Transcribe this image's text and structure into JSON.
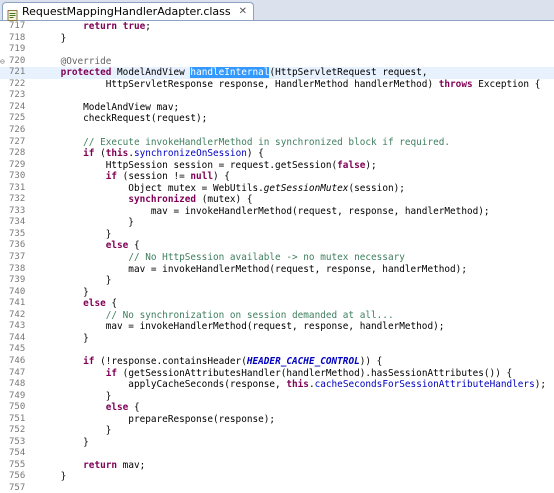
{
  "tab": {
    "title": "RequestMappingHandlerAdapter.class",
    "close_glyph": "✕",
    "icon": "class-file-icon"
  },
  "lines": [
    {
      "n": "717",
      "t": [
        [
          "        ",
          ""
        ],
        [
          "return",
          "kw"
        ],
        [
          " ",
          ""
        ],
        [
          "true",
          "kw"
        ],
        [
          ";",
          ""
        ]
      ]
    },
    {
      "n": "718",
      "t": [
        [
          "    }",
          ""
        ]
      ]
    },
    {
      "n": "719",
      "t": [
        [
          "",
          ""
        ]
      ]
    },
    {
      "n": "720",
      "t": [
        [
          "    ",
          ""
        ],
        [
          "@Override",
          "an"
        ]
      ],
      "fold": "⊖"
    },
    {
      "n": "721",
      "t": [
        [
          "    ",
          ""
        ],
        [
          "protected",
          "kw"
        ],
        [
          " ModelAndView ",
          ""
        ],
        [
          "handleInternal",
          "sel"
        ],
        [
          "(HttpServletRequest request,",
          ""
        ]
      ],
      "current": true
    },
    {
      "n": "722",
      "t": [
        [
          "            HttpServletResponse response, HandlerMethod handlerMethod) ",
          ""
        ],
        [
          "throws",
          "kw"
        ],
        [
          " Exception {",
          ""
        ]
      ]
    },
    {
      "n": "723",
      "t": [
        [
          "",
          ""
        ]
      ]
    },
    {
      "n": "724",
      "t": [
        [
          "        ModelAndView mav;",
          ""
        ]
      ]
    },
    {
      "n": "725",
      "t": [
        [
          "        checkRequest(request);",
          ""
        ]
      ]
    },
    {
      "n": "726",
      "t": [
        [
          "",
          ""
        ]
      ]
    },
    {
      "n": "727",
      "t": [
        [
          "        ",
          ""
        ],
        [
          "// Execute invokeHandlerMethod in synchronized block if required.",
          "cm"
        ]
      ]
    },
    {
      "n": "728",
      "t": [
        [
          "        ",
          ""
        ],
        [
          "if",
          "kw"
        ],
        [
          " (",
          ""
        ],
        [
          "this",
          "kw"
        ],
        [
          ".",
          ""
        ],
        [
          "synchronizeOnSession",
          "fld"
        ],
        [
          ") {",
          ""
        ]
      ]
    },
    {
      "n": "729",
      "t": [
        [
          "            HttpSession session = request.getSession(",
          ""
        ],
        [
          "false",
          "kw"
        ],
        [
          ");",
          ""
        ]
      ]
    },
    {
      "n": "730",
      "t": [
        [
          "            ",
          ""
        ],
        [
          "if",
          "kw"
        ],
        [
          " (session != ",
          ""
        ],
        [
          "null",
          "kw"
        ],
        [
          ") {",
          ""
        ]
      ]
    },
    {
      "n": "731",
      "t": [
        [
          "                Object mutex = WebUtils.",
          ""
        ],
        [
          "getSessionMutex",
          "it"
        ],
        [
          "(session);",
          ""
        ]
      ]
    },
    {
      "n": "732",
      "t": [
        [
          "                ",
          ""
        ],
        [
          "synchronized",
          "kw"
        ],
        [
          " (mutex) {",
          ""
        ]
      ]
    },
    {
      "n": "733",
      "t": [
        [
          "                    mav = invokeHandlerMethod(request, response, handlerMethod);",
          ""
        ]
      ]
    },
    {
      "n": "734",
      "t": [
        [
          "                }",
          ""
        ]
      ]
    },
    {
      "n": "735",
      "t": [
        [
          "            }",
          ""
        ]
      ]
    },
    {
      "n": "736",
      "t": [
        [
          "            ",
          ""
        ],
        [
          "else",
          "kw"
        ],
        [
          " {",
          ""
        ]
      ]
    },
    {
      "n": "737",
      "t": [
        [
          "                ",
          ""
        ],
        [
          "// No HttpSession available -> no mutex necessary",
          "cm"
        ]
      ]
    },
    {
      "n": "738",
      "t": [
        [
          "                mav = invokeHandlerMethod(request, response, handlerMethod);",
          ""
        ]
      ]
    },
    {
      "n": "739",
      "t": [
        [
          "            }",
          ""
        ]
      ]
    },
    {
      "n": "740",
      "t": [
        [
          "        }",
          ""
        ]
      ]
    },
    {
      "n": "741",
      "t": [
        [
          "        ",
          ""
        ],
        [
          "else",
          "kw"
        ],
        [
          " {",
          ""
        ]
      ]
    },
    {
      "n": "742",
      "t": [
        [
          "            ",
          ""
        ],
        [
          "// No synchronization on session demanded at all...",
          "cm"
        ]
      ]
    },
    {
      "n": "743",
      "t": [
        [
          "            mav = invokeHandlerMethod(request, response, handlerMethod);",
          ""
        ]
      ]
    },
    {
      "n": "744",
      "t": [
        [
          "        }",
          ""
        ]
      ]
    },
    {
      "n": "745",
      "t": [
        [
          "",
          ""
        ]
      ]
    },
    {
      "n": "746",
      "t": [
        [
          "        ",
          ""
        ],
        [
          "if",
          "kw"
        ],
        [
          " (!response.containsHeader(",
          ""
        ],
        [
          "HEADER_CACHE_CONTROL",
          "cst"
        ],
        [
          ")) {",
          ""
        ]
      ]
    },
    {
      "n": "747",
      "t": [
        [
          "            ",
          ""
        ],
        [
          "if",
          "kw"
        ],
        [
          " (getSessionAttributesHandler(handlerMethod).hasSessionAttributes()) {",
          ""
        ]
      ]
    },
    {
      "n": "748",
      "t": [
        [
          "                applyCacheSeconds(response, ",
          ""
        ],
        [
          "this",
          "kw"
        ],
        [
          ".",
          ""
        ],
        [
          "cacheSecondsForSessionAttributeHandlers",
          "fld"
        ],
        [
          ");",
          ""
        ]
      ]
    },
    {
      "n": "749",
      "t": [
        [
          "            }",
          ""
        ]
      ]
    },
    {
      "n": "750",
      "t": [
        [
          "            ",
          ""
        ],
        [
          "else",
          "kw"
        ],
        [
          " {",
          ""
        ]
      ]
    },
    {
      "n": "751",
      "t": [
        [
          "                prepareResponse(response);",
          ""
        ]
      ]
    },
    {
      "n": "752",
      "t": [
        [
          "            }",
          ""
        ]
      ]
    },
    {
      "n": "753",
      "t": [
        [
          "        }",
          ""
        ]
      ]
    },
    {
      "n": "754",
      "t": [
        [
          "",
          ""
        ]
      ]
    },
    {
      "n": "755",
      "t": [
        [
          "        ",
          ""
        ],
        [
          "return",
          "kw"
        ],
        [
          " mav;",
          ""
        ]
      ]
    },
    {
      "n": "756",
      "t": [
        [
          "    }",
          ""
        ]
      ]
    },
    {
      "n": "757",
      "t": [
        [
          "",
          ""
        ]
      ]
    }
  ]
}
